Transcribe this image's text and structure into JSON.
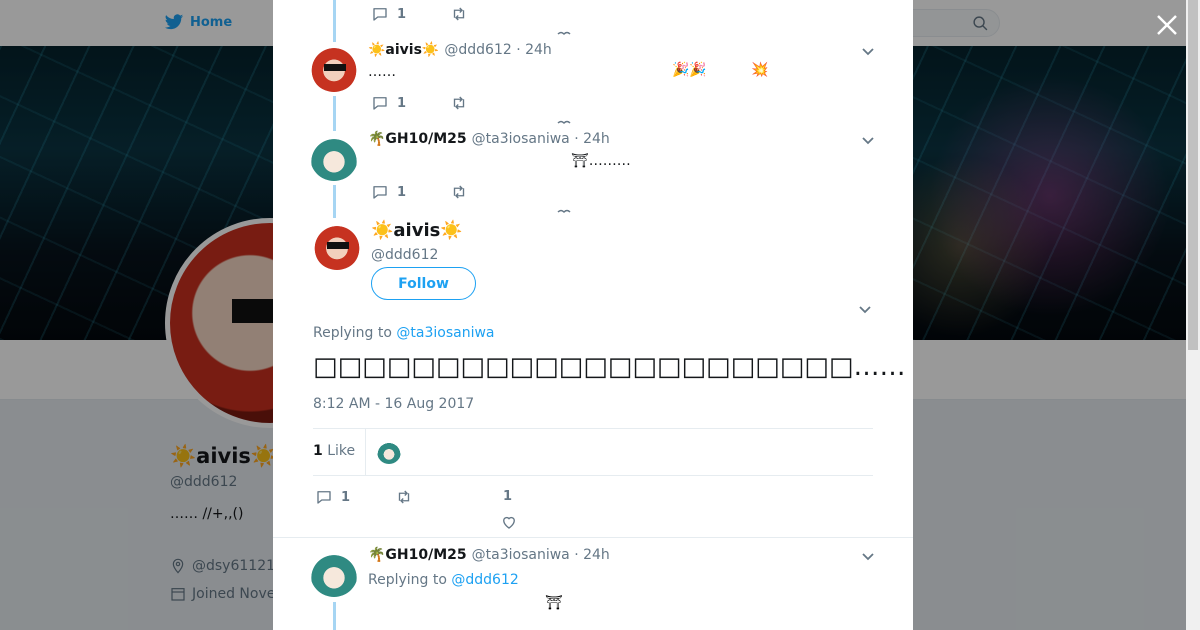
{
  "nav": {
    "home_label": "Home"
  },
  "profile": {
    "name": "☀️aivis☀️",
    "handle": "@ddd612",
    "bio": "……  //+,,()",
    "location": "@dsy61121",
    "joined": "Joined Nove"
  },
  "thread": [
    {
      "name": "☀️aivis☀️",
      "meta": "@ddd612 · 24h",
      "text": "……",
      "emojis": "🎉🎉",
      "emoji2": "💥",
      "reply_count": "1"
    },
    {
      "name": "🌴GH10/M25",
      "meta": "@ta3iosaniwa · 24h",
      "text": "⛩………",
      "reply_count": "1"
    }
  ],
  "main_tweet": {
    "name": "☀️aivis☀️",
    "handle": "@ddd612",
    "follow_label": "Follow",
    "replying_prefix": "Replying to",
    "replying_to": "@ta3iosaniwa",
    "text": "□□□□□□□□□□□□□□□□□□□□□□…… □□□□□□□□□□□□□□□□□□□□□□□□□□□□□□ □□□□□□□□□",
    "timestamp": "8:12 AM - 16 Aug 2017",
    "like_count": "1",
    "like_label": "Like",
    "reply_count": "1",
    "like_action_count": "1"
  },
  "reply": {
    "name": "🌴GH10/M25",
    "meta": "@ta3iosaniwa · 24h",
    "replying_prefix": "Replying to",
    "replying_to": "@ddd612",
    "emoji": "⛩"
  },
  "top_partial": {
    "reply_count": "1"
  },
  "colors": {
    "accent": "#1da1f2",
    "thread_line": "#a6d5f3",
    "text": "#14171a",
    "muted": "#657786"
  }
}
